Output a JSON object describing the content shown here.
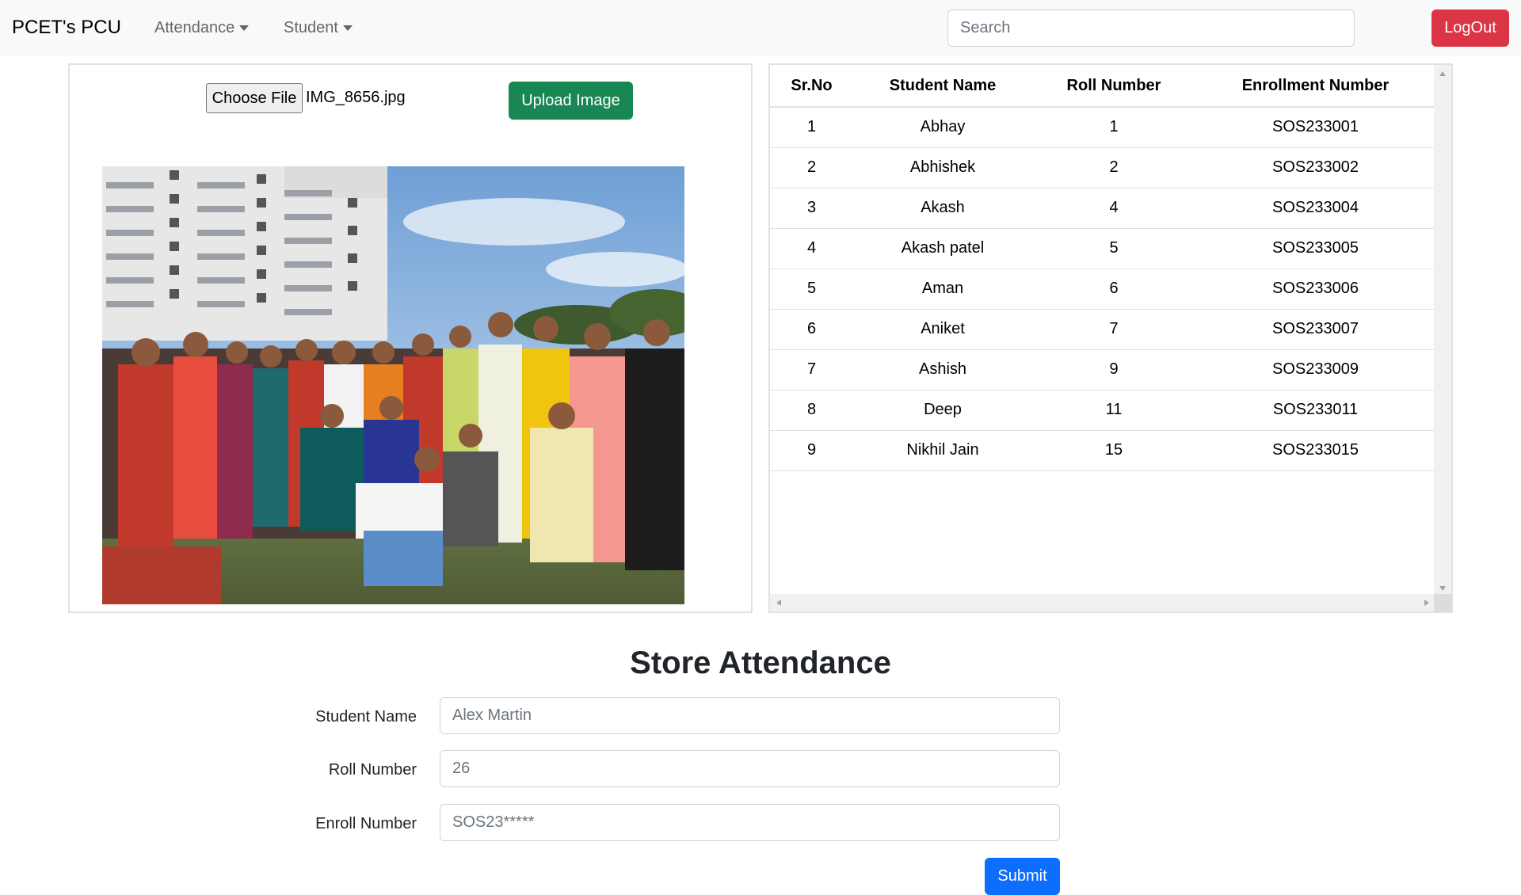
{
  "navbar": {
    "brand": "PCET's PCU",
    "menu": [
      {
        "label": "Attendance"
      },
      {
        "label": "Student"
      }
    ],
    "search_placeholder": "Search",
    "logout_label": "LogOut"
  },
  "upload": {
    "choose_label": "Choose File",
    "file_name": "IMG_8656.jpg",
    "upload_label": "Upload Image"
  },
  "table": {
    "headers": [
      "Sr.No",
      "Student Name",
      "Roll Number",
      "Enrollment Number"
    ],
    "rows": [
      [
        "1",
        "Abhay",
        "1",
        "SOS233001"
      ],
      [
        "2",
        "Abhishek",
        "2",
        "SOS233002"
      ],
      [
        "3",
        "Akash",
        "4",
        "SOS233004"
      ],
      [
        "4",
        "Akash patel",
        "5",
        "SOS233005"
      ],
      [
        "5",
        "Aman",
        "6",
        "SOS233006"
      ],
      [
        "6",
        "Aniket",
        "7",
        "SOS233007"
      ],
      [
        "7",
        "Ashish",
        "9",
        "SOS233009"
      ],
      [
        "8",
        "Deep",
        "11",
        "SOS233011"
      ],
      [
        "9",
        "Nikhil Jain",
        "15",
        "SOS233015"
      ]
    ]
  },
  "form": {
    "title": "Store Attendance",
    "fields": [
      {
        "label": "Student Name",
        "placeholder": "Alex Martin"
      },
      {
        "label": "Roll Number",
        "placeholder": "26"
      },
      {
        "label": "Enroll Number",
        "placeholder": "SOS23*****"
      }
    ],
    "submit_label": "Submit"
  },
  "colors": {
    "navbar_bg": "#f8f9fa",
    "danger": "#dc3545",
    "success": "#198754",
    "primary": "#0d6efd"
  }
}
